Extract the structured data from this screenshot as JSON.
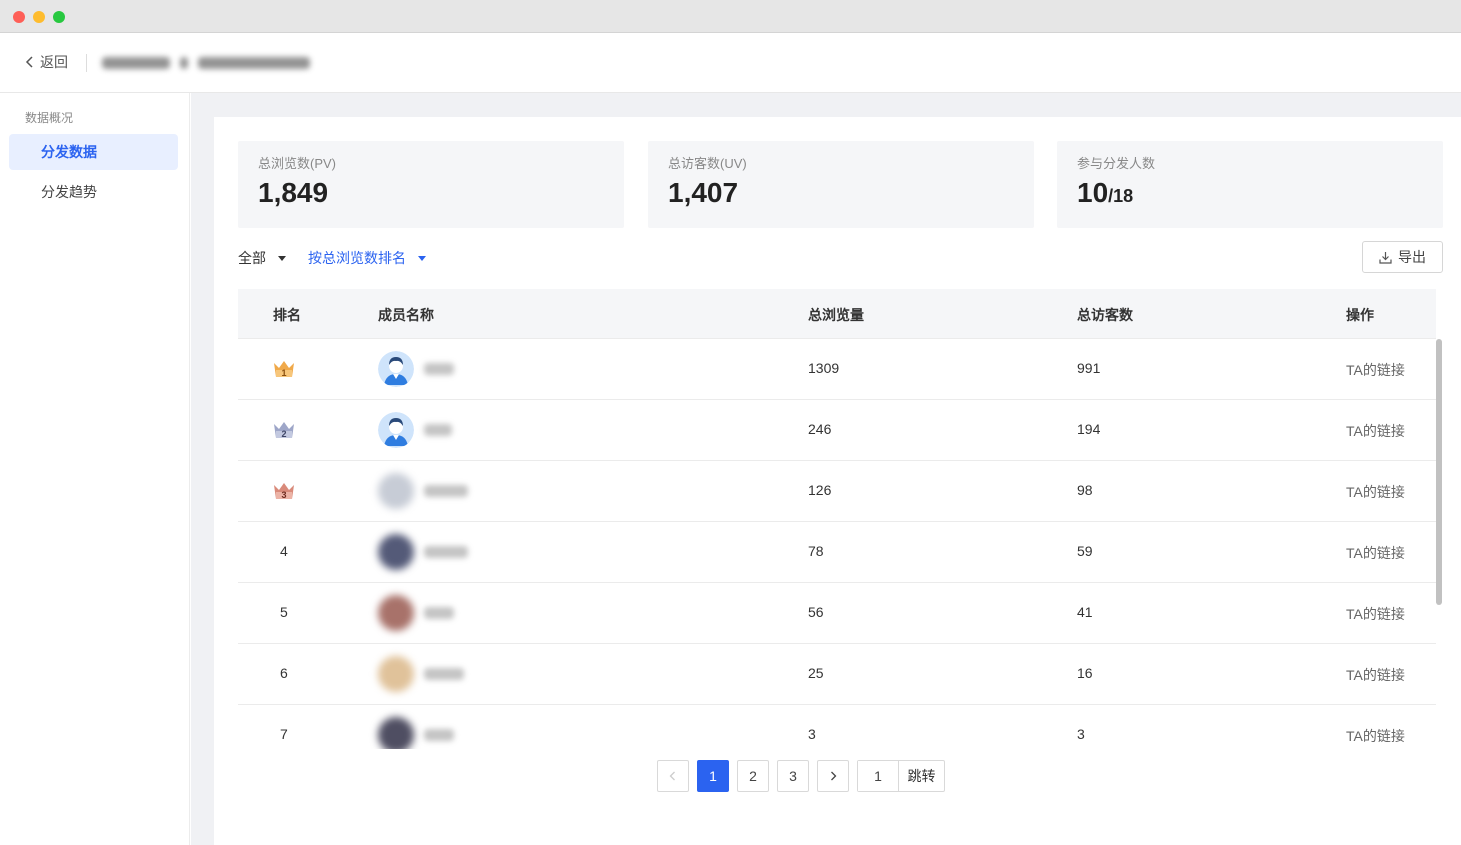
{
  "header": {
    "back_label": "返回"
  },
  "sidebar": {
    "group_label": "数据概况",
    "items": [
      {
        "label": "分发数据",
        "active": true
      },
      {
        "label": "分发趋势",
        "active": false
      }
    ]
  },
  "stats": [
    {
      "label": "总浏览数(PV)",
      "value": "1,849",
      "sub": ""
    },
    {
      "label": "总访客数(UV)",
      "value": "1,407",
      "sub": ""
    },
    {
      "label": "参与分发人数",
      "value": "10",
      "sub": "/18"
    }
  ],
  "filters": {
    "scope": "全部",
    "sort": "按总浏览数排名"
  },
  "export_label": "导出",
  "table": {
    "headers": {
      "rank": "排名",
      "name": "成员名称",
      "pv": "总浏览量",
      "uv": "总访客数",
      "op": "操作"
    },
    "rows": [
      {
        "rank": "1",
        "pv": "1309",
        "uv": "991",
        "op": "TA的链接"
      },
      {
        "rank": "2",
        "pv": "246",
        "uv": "194",
        "op": "TA的链接"
      },
      {
        "rank": "3",
        "pv": "126",
        "uv": "98",
        "op": "TA的链接"
      },
      {
        "rank": "4",
        "pv": "78",
        "uv": "59",
        "op": "TA的链接"
      },
      {
        "rank": "5",
        "pv": "56",
        "uv": "41",
        "op": "TA的链接"
      },
      {
        "rank": "6",
        "pv": "25",
        "uv": "16",
        "op": "TA的链接"
      },
      {
        "rank": "7",
        "pv": "3",
        "uv": "3",
        "op": "TA的链接"
      }
    ]
  },
  "pagination": {
    "pages": [
      "1",
      "2",
      "3"
    ],
    "current": "1",
    "jump_value": "1",
    "jump_label": "跳转"
  },
  "colors": {
    "accent": "#2b63f0",
    "gold": "#f0a94a",
    "silver": "#9ea6c8",
    "bronze": "#d98a7a"
  }
}
